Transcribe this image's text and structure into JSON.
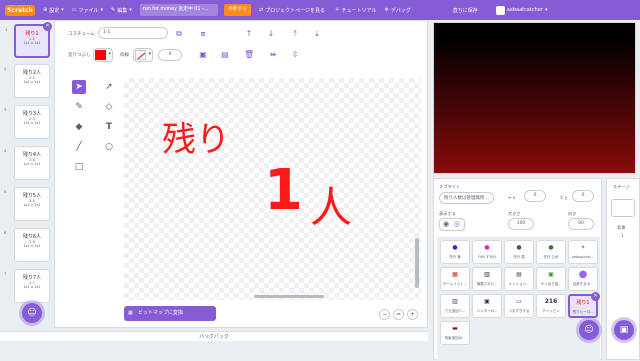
{
  "menubar": {
    "logo": "Scratch",
    "settings": "設定",
    "file": "ファイル",
    "edit": "編集",
    "project_title": "run for money 逃走中 01 -...",
    "share": "共有する",
    "project_page": "プロジェクトページを見る",
    "tutorial": "チュートリアル",
    "debug": "デバッグ",
    "save_now": "直ちに保存",
    "username": "aabaatcatcher"
  },
  "costumes": [
    {
      "num": "1",
      "thumb": "残り1",
      "name": "1-1",
      "size": "1x1 x 1x1"
    },
    {
      "num": "2",
      "thumb": "残り2人",
      "name": "2-2",
      "size": "1x1 x 1x1"
    },
    {
      "num": "3",
      "thumb": "残り3人",
      "name": "2-3",
      "size": "1x1 x 1x1"
    },
    {
      "num": "4",
      "thumb": "残り4人",
      "name": "2-4",
      "size": "1x1 x 1x1"
    },
    {
      "num": "5",
      "thumb": "残り5人",
      "name": "2-5",
      "size": "1x1 x 1x1"
    },
    {
      "num": "6",
      "thumb": "残り6人",
      "name": "2-6",
      "size": "1x1 x 1x1"
    },
    {
      "num": "7",
      "thumb": "残り7人",
      "name": "2-7",
      "size": "1x1 x 1x1"
    }
  ],
  "editor": {
    "costume_label": "コスチューム",
    "costume_name": "1-1",
    "fill_label": "塗りつぶし",
    "fill_color": "#ff0000",
    "outline_label": "枠線",
    "outline_width": "0",
    "canvas_text_1": "残り",
    "canvas_text_2": "1",
    "canvas_text_3": "人",
    "bitmap_button": "ビットマップに変換",
    "zoom_out": "−",
    "zoom_reset": "=",
    "zoom_in": "+"
  },
  "backpack": {
    "label": "バックパック"
  },
  "sprite_info": {
    "sprite_label": "スプライト",
    "sprite_name": "残り人数は管理無所...",
    "x_label": "x",
    "x_value": "0",
    "y_label": "y",
    "y_value": "0",
    "show_label": "表示する",
    "size_label": "大きさ",
    "size_value": "100",
    "direction_label": "向き",
    "direction_value": "90"
  },
  "sprites": [
    {
      "name": "先行 鬼",
      "icon": "●",
      "color": "#2a2adf"
    },
    {
      "name": "FUN すみれ",
      "icon": "●",
      "color": "#e020c0"
    },
    {
      "name": "先行 蘭",
      "icon": "●",
      "color": "#555555"
    },
    {
      "name": "先行 ひめ",
      "icon": "●",
      "color": "#3a7a3a"
    },
    {
      "name": "aabaatcatc...",
      "icon": "✦",
      "color": "#888888"
    },
    {
      "name": "ゲームリスト...",
      "icon": "▦",
      "color": "#cc2222"
    },
    {
      "name": "捕獲された...",
      "icon": "▥",
      "color": "#222222"
    },
    {
      "name": "ミッション...",
      "icon": "▤",
      "color": "#444444"
    },
    {
      "name": "やっぱり逃...",
      "icon": "▣",
      "color": "#2a9a2a"
    },
    {
      "name": "自首するボ...",
      "icon": "●",
      "color": "#9966ff"
    },
    {
      "name": "でも追加へ...",
      "icon": "▥",
      "color": "#444444"
    },
    {
      "name": "ハンターの...",
      "icon": "▣",
      "color": "#333333"
    },
    {
      "name": "つまずきする",
      "icon": "▭",
      "color": "#333333"
    },
    {
      "name": "チャッピン",
      "icon": "216",
      "color": "#333333"
    },
    {
      "name": "残りヒーロ...",
      "icon": "残り1",
      "color": "#ff0000"
    },
    {
      "name": "背景追加の...",
      "icon": "▬",
      "color": "#8a0b0b"
    }
  ],
  "stage_pane": {
    "title": "ステージ",
    "backdrops_label": "背景",
    "backdrops_count": "1"
  }
}
